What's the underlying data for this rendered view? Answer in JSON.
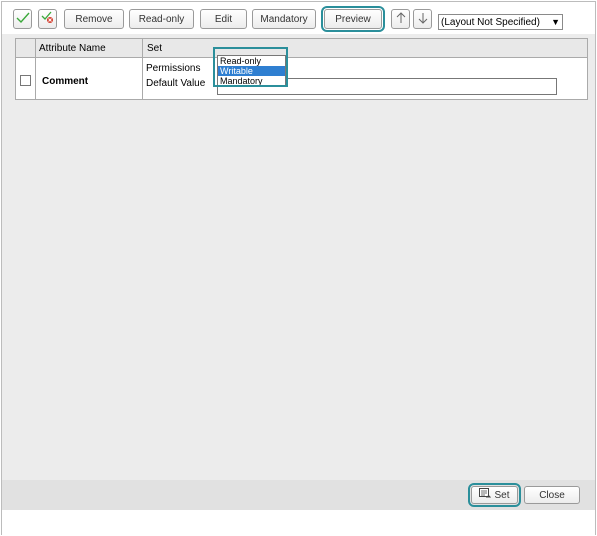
{
  "toolbar": {
    "check_icon": "check-icon",
    "uncheck_icon": "uncheck-icon",
    "remove_label": "Remove",
    "readonly_label": "Read-only",
    "edit_label": "Edit",
    "mandatory_label": "Mandatory",
    "preview_label": "Preview",
    "move_up_icon": "arrow-up-icon",
    "move_down_icon": "arrow-down-icon",
    "layout_select": "(Layout Not Specified)"
  },
  "grid": {
    "columns": [
      "Attribute Name",
      "Set"
    ],
    "row": {
      "checked": false,
      "attribute_name": "Comment",
      "permissions_label": "Permissions",
      "default_value_label": "Default Value",
      "default_value": "",
      "permission_options": [
        "Read-only",
        "Writable",
        "Mandatory"
      ],
      "selected_permission": "Writable"
    }
  },
  "footer": {
    "set_label": "Set",
    "close_label": "Close"
  },
  "colors": {
    "highlight": "#2b8f9b",
    "selection": "#2f7fd1",
    "check_green": "#3aa83a",
    "uncheck_red": "#d23a2a"
  }
}
